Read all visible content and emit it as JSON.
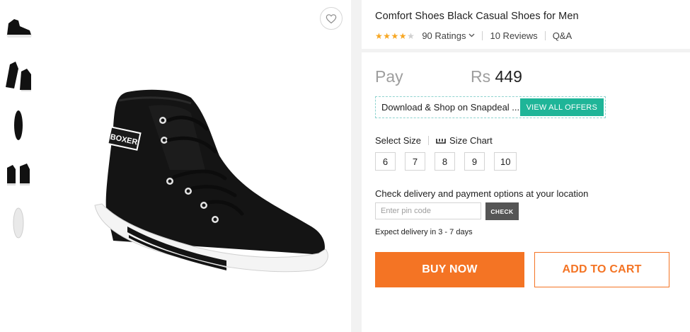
{
  "product": {
    "title": "Comfort Shoes Black Casual Shoes for Men",
    "rating": {
      "stars_filled": 4,
      "stars_total": 5,
      "ratings_label": "90 Ratings",
      "reviews_label": "10 Reviews",
      "qa_label": "Q&A"
    }
  },
  "pricing": {
    "pay_label": "Pay",
    "currency": "Rs",
    "amount": "449"
  },
  "offer": {
    "text": "Download & Shop on Snapdeal ...",
    "button": "VIEW ALL OFFERS"
  },
  "sizes": {
    "label": "Select Size",
    "chart_label": "Size Chart",
    "options": [
      "6",
      "7",
      "8",
      "9",
      "10"
    ]
  },
  "delivery": {
    "label": "Check delivery and payment options at your location",
    "placeholder": "Enter pin code",
    "check_button": "CHECK",
    "expect": "Expect delivery in 3 - 7 days"
  },
  "actions": {
    "buy_now": "BUY NOW",
    "add_to_cart": "ADD TO CART"
  },
  "colors": {
    "accent": "#f47424",
    "offer_green": "#1fb598",
    "star": "#f7a723"
  },
  "gallery": {
    "thumbnail_count": 5,
    "icons": [
      "heart-icon",
      "ruler-icon",
      "chevron-down-icon"
    ]
  }
}
